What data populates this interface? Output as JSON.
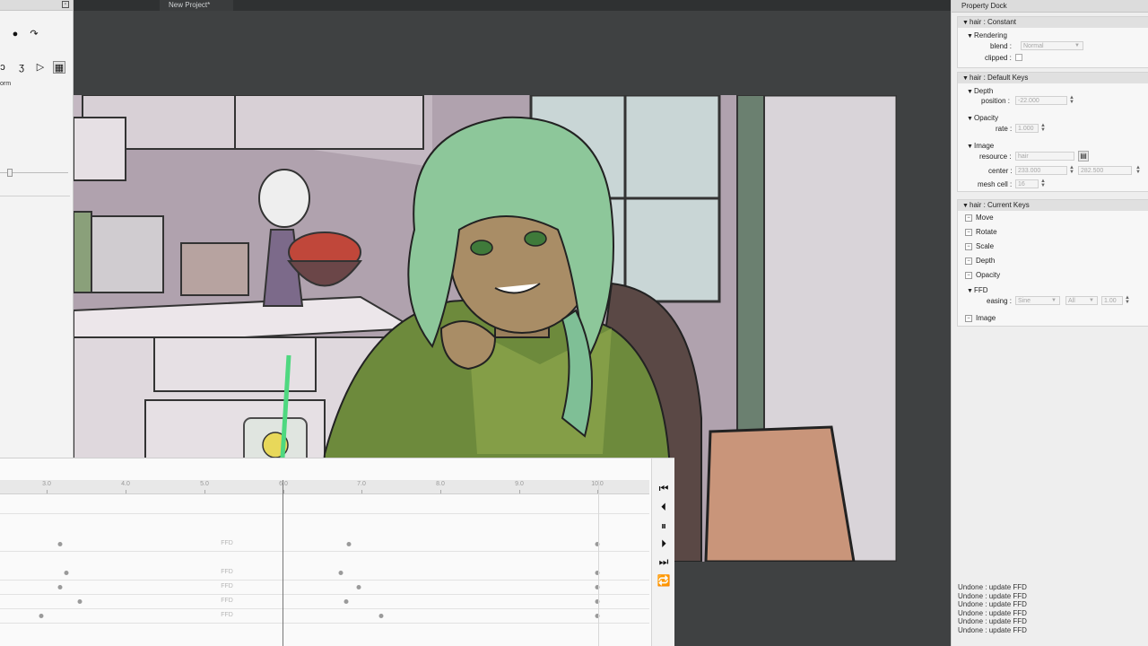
{
  "doc_tab": {
    "title": "New Project*"
  },
  "left_panel": {
    "tools_row1": [
      {
        "icon": "dot-icon",
        "glyph": "●"
      },
      {
        "icon": "curve-arrow-icon",
        "glyph": "↷"
      }
    ],
    "tools_row2": [
      {
        "icon": "lasso-icon",
        "glyph": "ↄ"
      },
      {
        "icon": "bone-icon",
        "glyph": "ʒ"
      },
      {
        "icon": "play-select-icon",
        "glyph": "▷"
      },
      {
        "icon": "mesh-grid-icon",
        "glyph": "▦"
      }
    ],
    "mode_label": "orm"
  },
  "timeline": {
    "ruler": [
      {
        "label": "3.0",
        "pos": 52
      },
      {
        "label": "4.0",
        "pos": 140
      },
      {
        "label": "5.0",
        "pos": 228
      },
      {
        "label": "6.0",
        "pos": 316
      },
      {
        "label": "7.0",
        "pos": 403
      },
      {
        "label": "8.0",
        "pos": 491
      },
      {
        "label": "9.0",
        "pos": 579
      },
      {
        "label": "10.0",
        "pos": 666
      }
    ],
    "current_time": 6.0,
    "tracks": [
      {
        "keys": [],
        "ffd": false
      },
      {
        "keys": [
          3.17,
          6.84,
          10.0
        ],
        "ffd": true
      },
      {
        "keys": [
          3.25,
          6.74,
          10.0
        ],
        "ffd": true
      },
      {
        "keys": [
          3.17,
          6.97,
          10.0
        ],
        "ffd": true
      },
      {
        "keys": [
          3.42,
          6.81,
          10.0
        ],
        "ffd": true
      },
      {
        "keys": [
          2.93,
          7.25,
          10.0
        ],
        "ffd": true
      }
    ],
    "ffd_label": "FFD",
    "transport": [
      {
        "name": "first-frame-button",
        "icon": "skip-start-icon",
        "glyph": "⏮"
      },
      {
        "name": "prev-frame-button",
        "icon": "step-back-icon",
        "glyph": "⏴"
      },
      {
        "name": "pause-button",
        "icon": "pause-icon",
        "glyph": "⏸"
      },
      {
        "name": "next-frame-button",
        "icon": "step-forward-icon",
        "glyph": "⏵"
      },
      {
        "name": "last-frame-button",
        "icon": "skip-end-icon",
        "glyph": "⏭"
      },
      {
        "name": "loop-button",
        "icon": "loop-icon",
        "glyph": "🔁"
      }
    ]
  },
  "dock": {
    "title": "Property Dock",
    "constant": {
      "header": "hair : Constant",
      "rendering": "Rendering",
      "blend_label": "blend :",
      "blend_value": "Normal",
      "clipped_label": "clipped :"
    },
    "default_keys": {
      "header": "hair : Default Keys",
      "depth": "Depth",
      "position_label": "position :",
      "position_value": "-22.000",
      "opacity": "Opacity",
      "rate_label": "rate :",
      "rate_value": "1.000",
      "image": "Image",
      "resource_label": "resource :",
      "resource_value": "hair",
      "center_label": "center :",
      "center_x": "233.000",
      "center_y": "282.500",
      "mesh_label": "mesh cell :",
      "mesh_value": "16"
    },
    "current_keys": {
      "header": "hair : Current Keys",
      "items": [
        "Move",
        "Rotate",
        "Scale",
        "Depth",
        "Opacity"
      ],
      "ffd": "FFD",
      "easing_label": "easing :",
      "easing_value": "Sine",
      "easing_range": "All",
      "easing_amount": "1.00",
      "image_item": "Image"
    },
    "undo_log": [
      "Undone : update FFD",
      "Undone : update FFD",
      "Undone : update FFD",
      "Undone : update FFD",
      "Undone : update FFD",
      "Undone : update FFD"
    ]
  },
  "colors": {
    "background": "#3f4142",
    "hair": "#8dc79a",
    "hoodie": "#6d8a3c",
    "skin": "#a98d66",
    "wall": "#b4a7b2",
    "chair_cover": "#c9957a"
  }
}
